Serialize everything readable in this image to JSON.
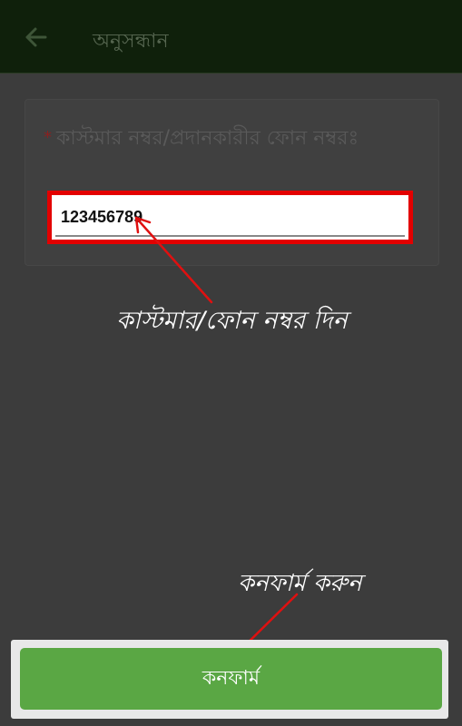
{
  "appbar": {
    "title": "অনুসন্ধান",
    "back_icon": "arrow-left-icon"
  },
  "form": {
    "required_mark": "*",
    "label": "কাস্টমার নম্বর/প্রদানকারীর ফোন নম্বরঃ",
    "value": "123456789"
  },
  "annotations": {
    "enter_number": "কাস্টমার/ফোন নম্বর দিন",
    "confirm_hint": "কনফার্ম করুন"
  },
  "confirm_label": "কনফার্ম",
  "colors": {
    "highlight": "#e30000",
    "button": "#5aa744",
    "appbar": "#0f200b"
  }
}
